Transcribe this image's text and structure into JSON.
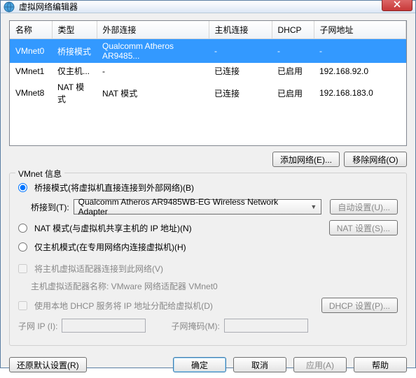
{
  "window": {
    "title": "虚拟网络编辑器"
  },
  "table": {
    "headers": [
      "名称",
      "类型",
      "外部连接",
      "主机连接",
      "DHCP",
      "子网地址"
    ],
    "rows": [
      {
        "name": "VMnet0",
        "type": "桥接模式",
        "ext": "Qualcomm Atheros AR9485...",
        "host": "-",
        "dhcp": "-",
        "subnet": "-",
        "selected": true
      },
      {
        "name": "VMnet1",
        "type": "仅主机...",
        "ext": "-",
        "host": "已连接",
        "dhcp": "已启用",
        "subnet": "192.168.92.0",
        "selected": false
      },
      {
        "name": "VMnet8",
        "type": "NAT 模式",
        "ext": "NAT 模式",
        "host": "已连接",
        "dhcp": "已启用",
        "subnet": "192.168.183.0",
        "selected": false
      }
    ]
  },
  "buttons": {
    "add_net": "添加网络(E)...",
    "remove_net": "移除网络(O)"
  },
  "vmnet_info": {
    "title": "VMnet 信息",
    "bridge_radio": "桥接模式(将虚拟机直接连接到外部网络)(B)",
    "bridge_to_label": "桥接到(T):",
    "bridge_adapter": "Qualcomm Atheros AR9485WB-EG Wireless Network Adapter",
    "auto_settings": "自动设置(U)...",
    "nat_radio": "NAT 模式(与虚拟机共享主机的 IP 地址)(N)",
    "nat_settings": "NAT 设置(S)...",
    "hostonly_radio": "仅主机模式(在专用网络内连接虚拟机)(H)",
    "connect_host_chk": "将主机虚拟适配器连接到此网络(V)",
    "host_adapter_name_label": "主机虚拟适配器名称: VMware 网络适配器 VMnet0",
    "use_dhcp_chk": "使用本地 DHCP 服务将 IP 地址分配给虚拟机(D)",
    "dhcp_settings": "DHCP 设置(P)...",
    "subnet_ip_label": "子网 IP (I):",
    "subnet_mask_label": "子网掩码(M):"
  },
  "footer": {
    "restore": "还原默认设置(R)",
    "ok": "确定",
    "cancel": "取消",
    "apply": "应用(A)",
    "help": "帮助"
  }
}
